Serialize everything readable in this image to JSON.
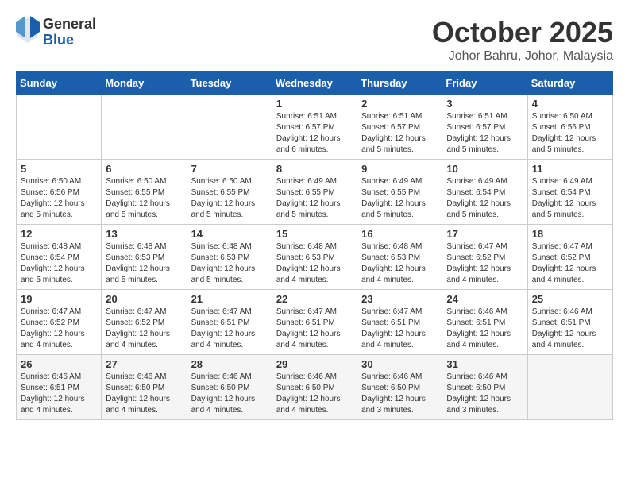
{
  "header": {
    "logo": {
      "line1": "General",
      "line2": "Blue"
    },
    "title": "October 2025",
    "location": "Johor Bahru, Johor, Malaysia"
  },
  "weekdays": [
    "Sunday",
    "Monday",
    "Tuesday",
    "Wednesday",
    "Thursday",
    "Friday",
    "Saturday"
  ],
  "weeks": [
    [
      {
        "day": "",
        "info": ""
      },
      {
        "day": "",
        "info": ""
      },
      {
        "day": "",
        "info": ""
      },
      {
        "day": "1",
        "info": "Sunrise: 6:51 AM\nSunset: 6:57 PM\nDaylight: 12 hours\nand 6 minutes."
      },
      {
        "day": "2",
        "info": "Sunrise: 6:51 AM\nSunset: 6:57 PM\nDaylight: 12 hours\nand 5 minutes."
      },
      {
        "day": "3",
        "info": "Sunrise: 6:51 AM\nSunset: 6:57 PM\nDaylight: 12 hours\nand 5 minutes."
      },
      {
        "day": "4",
        "info": "Sunrise: 6:50 AM\nSunset: 6:56 PM\nDaylight: 12 hours\nand 5 minutes."
      }
    ],
    [
      {
        "day": "5",
        "info": "Sunrise: 6:50 AM\nSunset: 6:56 PM\nDaylight: 12 hours\nand 5 minutes."
      },
      {
        "day": "6",
        "info": "Sunrise: 6:50 AM\nSunset: 6:55 PM\nDaylight: 12 hours\nand 5 minutes."
      },
      {
        "day": "7",
        "info": "Sunrise: 6:50 AM\nSunset: 6:55 PM\nDaylight: 12 hours\nand 5 minutes."
      },
      {
        "day": "8",
        "info": "Sunrise: 6:49 AM\nSunset: 6:55 PM\nDaylight: 12 hours\nand 5 minutes."
      },
      {
        "day": "9",
        "info": "Sunrise: 6:49 AM\nSunset: 6:55 PM\nDaylight: 12 hours\nand 5 minutes."
      },
      {
        "day": "10",
        "info": "Sunrise: 6:49 AM\nSunset: 6:54 PM\nDaylight: 12 hours\nand 5 minutes."
      },
      {
        "day": "11",
        "info": "Sunrise: 6:49 AM\nSunset: 6:54 PM\nDaylight: 12 hours\nand 5 minutes."
      }
    ],
    [
      {
        "day": "12",
        "info": "Sunrise: 6:48 AM\nSunset: 6:54 PM\nDaylight: 12 hours\nand 5 minutes."
      },
      {
        "day": "13",
        "info": "Sunrise: 6:48 AM\nSunset: 6:53 PM\nDaylight: 12 hours\nand 5 minutes."
      },
      {
        "day": "14",
        "info": "Sunrise: 6:48 AM\nSunset: 6:53 PM\nDaylight: 12 hours\nand 5 minutes."
      },
      {
        "day": "15",
        "info": "Sunrise: 6:48 AM\nSunset: 6:53 PM\nDaylight: 12 hours\nand 4 minutes."
      },
      {
        "day": "16",
        "info": "Sunrise: 6:48 AM\nSunset: 6:53 PM\nDaylight: 12 hours\nand 4 minutes."
      },
      {
        "day": "17",
        "info": "Sunrise: 6:47 AM\nSunset: 6:52 PM\nDaylight: 12 hours\nand 4 minutes."
      },
      {
        "day": "18",
        "info": "Sunrise: 6:47 AM\nSunset: 6:52 PM\nDaylight: 12 hours\nand 4 minutes."
      }
    ],
    [
      {
        "day": "19",
        "info": "Sunrise: 6:47 AM\nSunset: 6:52 PM\nDaylight: 12 hours\nand 4 minutes."
      },
      {
        "day": "20",
        "info": "Sunrise: 6:47 AM\nSunset: 6:52 PM\nDaylight: 12 hours\nand 4 minutes."
      },
      {
        "day": "21",
        "info": "Sunrise: 6:47 AM\nSunset: 6:51 PM\nDaylight: 12 hours\nand 4 minutes."
      },
      {
        "day": "22",
        "info": "Sunrise: 6:47 AM\nSunset: 6:51 PM\nDaylight: 12 hours\nand 4 minutes."
      },
      {
        "day": "23",
        "info": "Sunrise: 6:47 AM\nSunset: 6:51 PM\nDaylight: 12 hours\nand 4 minutes."
      },
      {
        "day": "24",
        "info": "Sunrise: 6:46 AM\nSunset: 6:51 PM\nDaylight: 12 hours\nand 4 minutes."
      },
      {
        "day": "25",
        "info": "Sunrise: 6:46 AM\nSunset: 6:51 PM\nDaylight: 12 hours\nand 4 minutes."
      }
    ],
    [
      {
        "day": "26",
        "info": "Sunrise: 6:46 AM\nSunset: 6:51 PM\nDaylight: 12 hours\nand 4 minutes."
      },
      {
        "day": "27",
        "info": "Sunrise: 6:46 AM\nSunset: 6:50 PM\nDaylight: 12 hours\nand 4 minutes."
      },
      {
        "day": "28",
        "info": "Sunrise: 6:46 AM\nSunset: 6:50 PM\nDaylight: 12 hours\nand 4 minutes."
      },
      {
        "day": "29",
        "info": "Sunrise: 6:46 AM\nSunset: 6:50 PM\nDaylight: 12 hours\nand 4 minutes."
      },
      {
        "day": "30",
        "info": "Sunrise: 6:46 AM\nSunset: 6:50 PM\nDaylight: 12 hours\nand 3 minutes."
      },
      {
        "day": "31",
        "info": "Sunrise: 6:46 AM\nSunset: 6:50 PM\nDaylight: 12 hours\nand 3 minutes."
      },
      {
        "day": "",
        "info": ""
      }
    ]
  ]
}
